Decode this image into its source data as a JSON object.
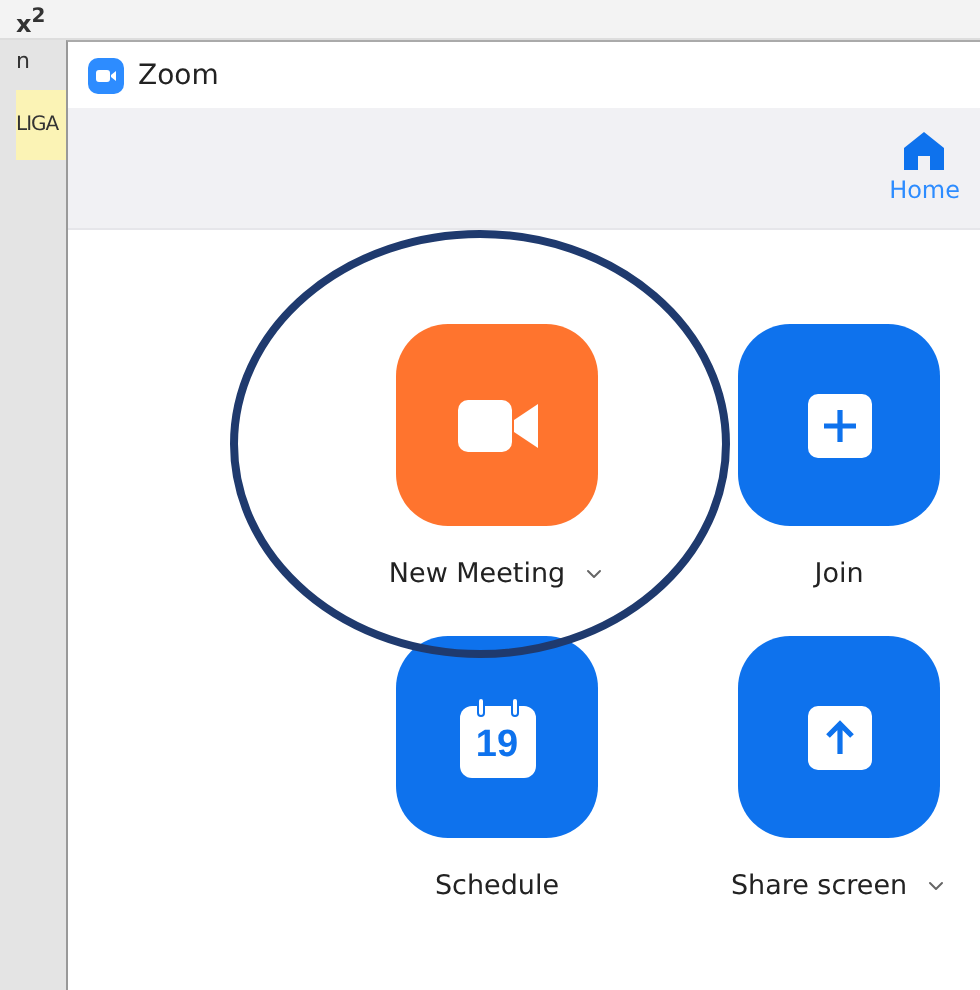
{
  "background_app": {
    "toolbar_label": "x$^{2}$",
    "side_labels": [
      {
        "text": "n",
        "highlighted": false
      },
      {
        "text": "LIGA",
        "highlighted": true
      }
    ]
  },
  "window": {
    "title": "Zoom"
  },
  "nav": [
    {
      "label": "Home",
      "selected": true
    }
  ],
  "actions": [
    {
      "label": "New Meeting",
      "kind": "video",
      "color": "#ff742e",
      "has_menu": true,
      "circled": true
    },
    {
      "label": "Join",
      "kind": "plus",
      "color": "#0e72ed",
      "has_menu": false,
      "circled": false
    },
    {
      "label": "Schedule",
      "kind": "calendar",
      "icon_text": "19",
      "color": "#0e72ed",
      "has_menu": false,
      "circled": false
    },
    {
      "label": "Share screen",
      "kind": "share",
      "color": "#0e72ed",
      "has_menu": true,
      "circled": false
    }
  ]
}
